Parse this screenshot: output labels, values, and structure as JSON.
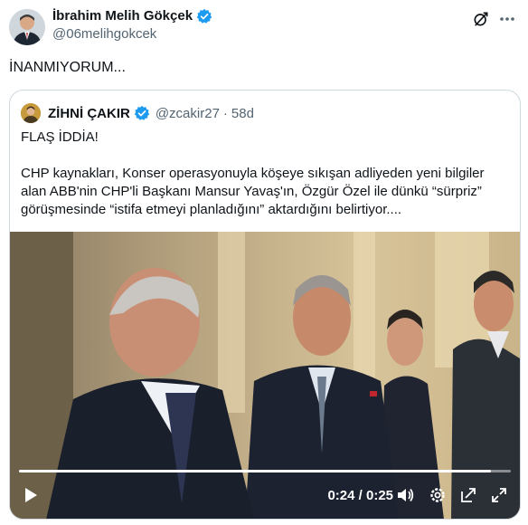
{
  "author": {
    "name": "İbrahim Melih Gökçek",
    "handle": "@06melihgokcek"
  },
  "tweet": {
    "text": "İNANMIYORUM..."
  },
  "quote": {
    "name": "ZİHNİ ÇAKIR",
    "handle": "@zcakir27",
    "separator": "·",
    "time": "58d",
    "headline": "FLAŞ İDDİA!",
    "body": "CHP kaynakları, Konser operasyonuyla köşeye sıkışan adliyeden yeni bilgiler alan ABB'nin CHP'li Başkanı Mansur Yavaş'ın, Özgür Özel ile dünkü “sürpriz” görüşmesinde “istifa etmeyi planladığını” aktardığını belirtiyor...."
  },
  "video": {
    "time_display": "0:24 / 0:25",
    "progress": 0.96
  },
  "colors": {
    "verified": "#1d9bf0",
    "text": "#0f1419",
    "secondary": "#536471",
    "border": "#cfd9de"
  },
  "icons": [
    "verified-badge-icon",
    "grok-icon",
    "more-icon",
    "play-icon",
    "volume-icon",
    "settings-icon",
    "pop-out-icon",
    "fullscreen-icon"
  ]
}
